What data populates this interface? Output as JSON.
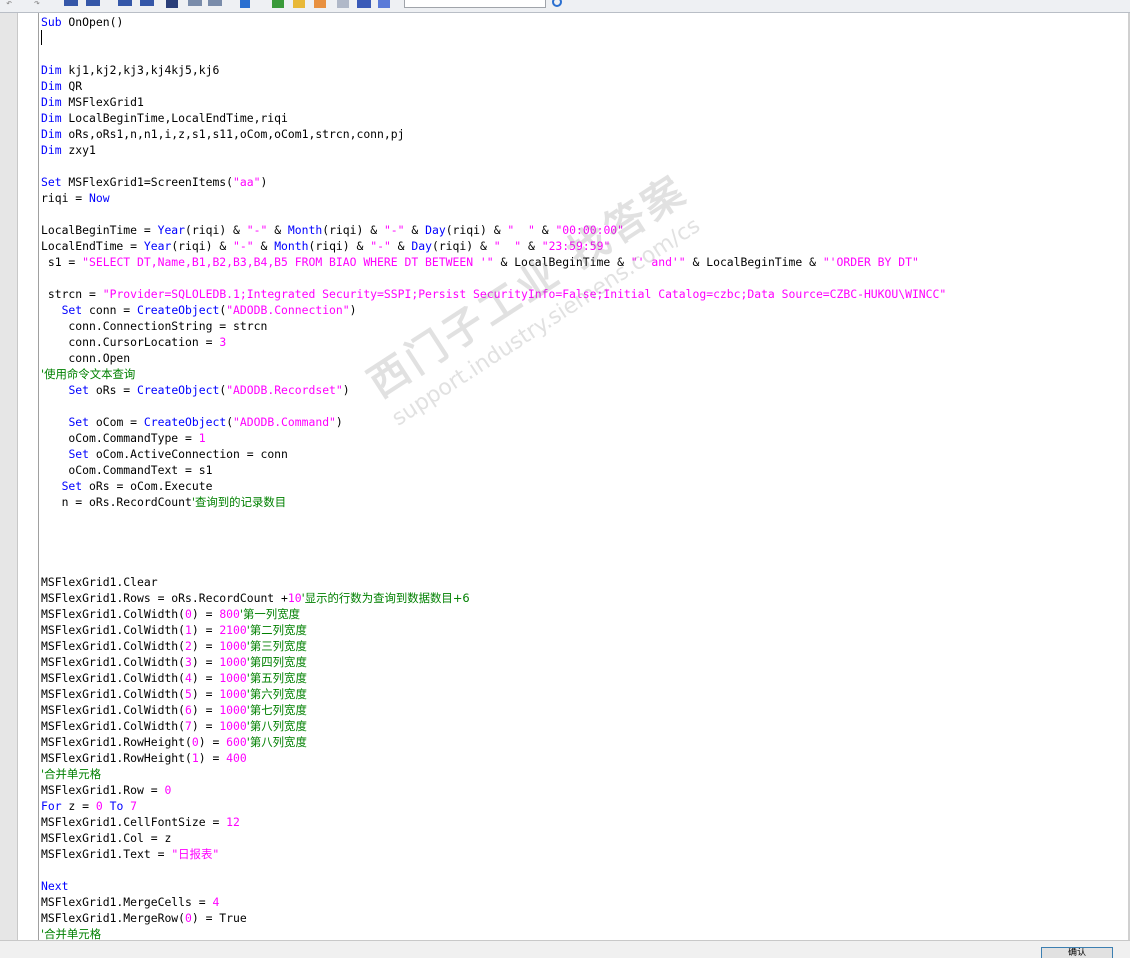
{
  "toolbar": {
    "icons": [
      "undo-icon",
      "redo-icon",
      "indent-icon",
      "outdent-icon",
      "align-left-icon",
      "align-right-icon",
      "bookmark-icon",
      "find-replace-icon",
      "up-arrow-icon",
      "check-icon",
      "folder-icon",
      "image-icon",
      "tag-icon",
      "search-icon"
    ],
    "search_value": ""
  },
  "watermark": {
    "cn": "西门子工业 找答案",
    "url": "support.industry.siemens.com/cs"
  },
  "status": {
    "button_label": "确认"
  },
  "code_lines": [
    "Sub OnOpen()",
    "",
    "",
    "Dim kj1,kj2,kj3,kj4kj5,kj6",
    "Dim QR",
    "Dim MSFlexGrid1",
    "Dim LocalBeginTime,LocalEndTime,riqi",
    "Dim oRs,oRs1,n,n1,i,z,s1,s11,oCom,oCom1,strcn,conn,pj",
    "Dim zxy1",
    "",
    "Set MSFlexGrid1=ScreenItems(\"aa\")",
    "riqi = Now",
    "",
    "LocalBeginTime = Year(riqi) & \"-\" & Month(riqi) & \"-\" & Day(riqi) & \"  \" & \"00:00:00\"",
    "LocalEndTime = Year(riqi) & \"-\" & Month(riqi) & \"-\" & Day(riqi) & \"  \" & \"23:59:59\"",
    " s1 = \"SELECT DT,Name,B1,B2,B3,B4,B5 FROM BIAO WHERE DT BETWEEN '\" & LocalBeginTime & \"' and'\" & LocalBeginTime & \"'ORDER BY DT\"",
    "",
    " strcn = \"Provider=SQLOLEDB.1;Integrated Security=SSPI;Persist SecurityInfo=False;Initial Catalog=czbc;Data Source=CZBC-HUKOU\\WINCC\"",
    "   Set conn = CreateObject(\"ADODB.Connection\")",
    "    conn.ConnectionString = strcn",
    "    conn.CursorLocation = 3",
    "    conn.Open",
    "'使用命令文本查询",
    "    Set oRs = CreateObject(\"ADODB.Recordset\")",
    "",
    "    Set oCom = CreateObject(\"ADODB.Command\")",
    "    oCom.CommandType = 1",
    "    Set oCom.ActiveConnection = conn",
    "    oCom.CommandText = s1",
    "   Set oRs = oCom.Execute",
    "   n = oRs.RecordCount'查询到的记录数目",
    "",
    "",
    "",
    "",
    "MSFlexGrid1.Clear",
    "MSFlexGrid1.Rows = oRs.RecordCount +10'显示的行数为查询到数据数目+6",
    "MSFlexGrid1.ColWidth(0) = 800'第一列宽度",
    "MSFlexGrid1.ColWidth(1) = 2100'第二列宽度",
    "MSFlexGrid1.ColWidth(2) = 1000'第三列宽度",
    "MSFlexGrid1.ColWidth(3) = 1000'第四列宽度",
    "MSFlexGrid1.ColWidth(4) = 1000'第五列宽度",
    "MSFlexGrid1.ColWidth(5) = 1000'第六列宽度",
    "MSFlexGrid1.ColWidth(6) = 1000'第七列宽度",
    "MSFlexGrid1.ColWidth(7) = 1000'第八列宽度",
    "MSFlexGrid1.RowHeight(0) = 600'第八列宽度",
    "MSFlexGrid1.RowHeight(1) = 400",
    "'合并单元格",
    "MSFlexGrid1.Row = 0",
    "For z = 0 To 7",
    "MSFlexGrid1.CellFontSize = 12",
    "MSFlexGrid1.Col = z",
    "MSFlexGrid1.Text = \"日报表\"",
    "",
    "Next",
    "MSFlexGrid1.MergeCells = 4",
    "MSFlexGrid1.MergeRow(0) = True",
    "'合并单元格"
  ]
}
